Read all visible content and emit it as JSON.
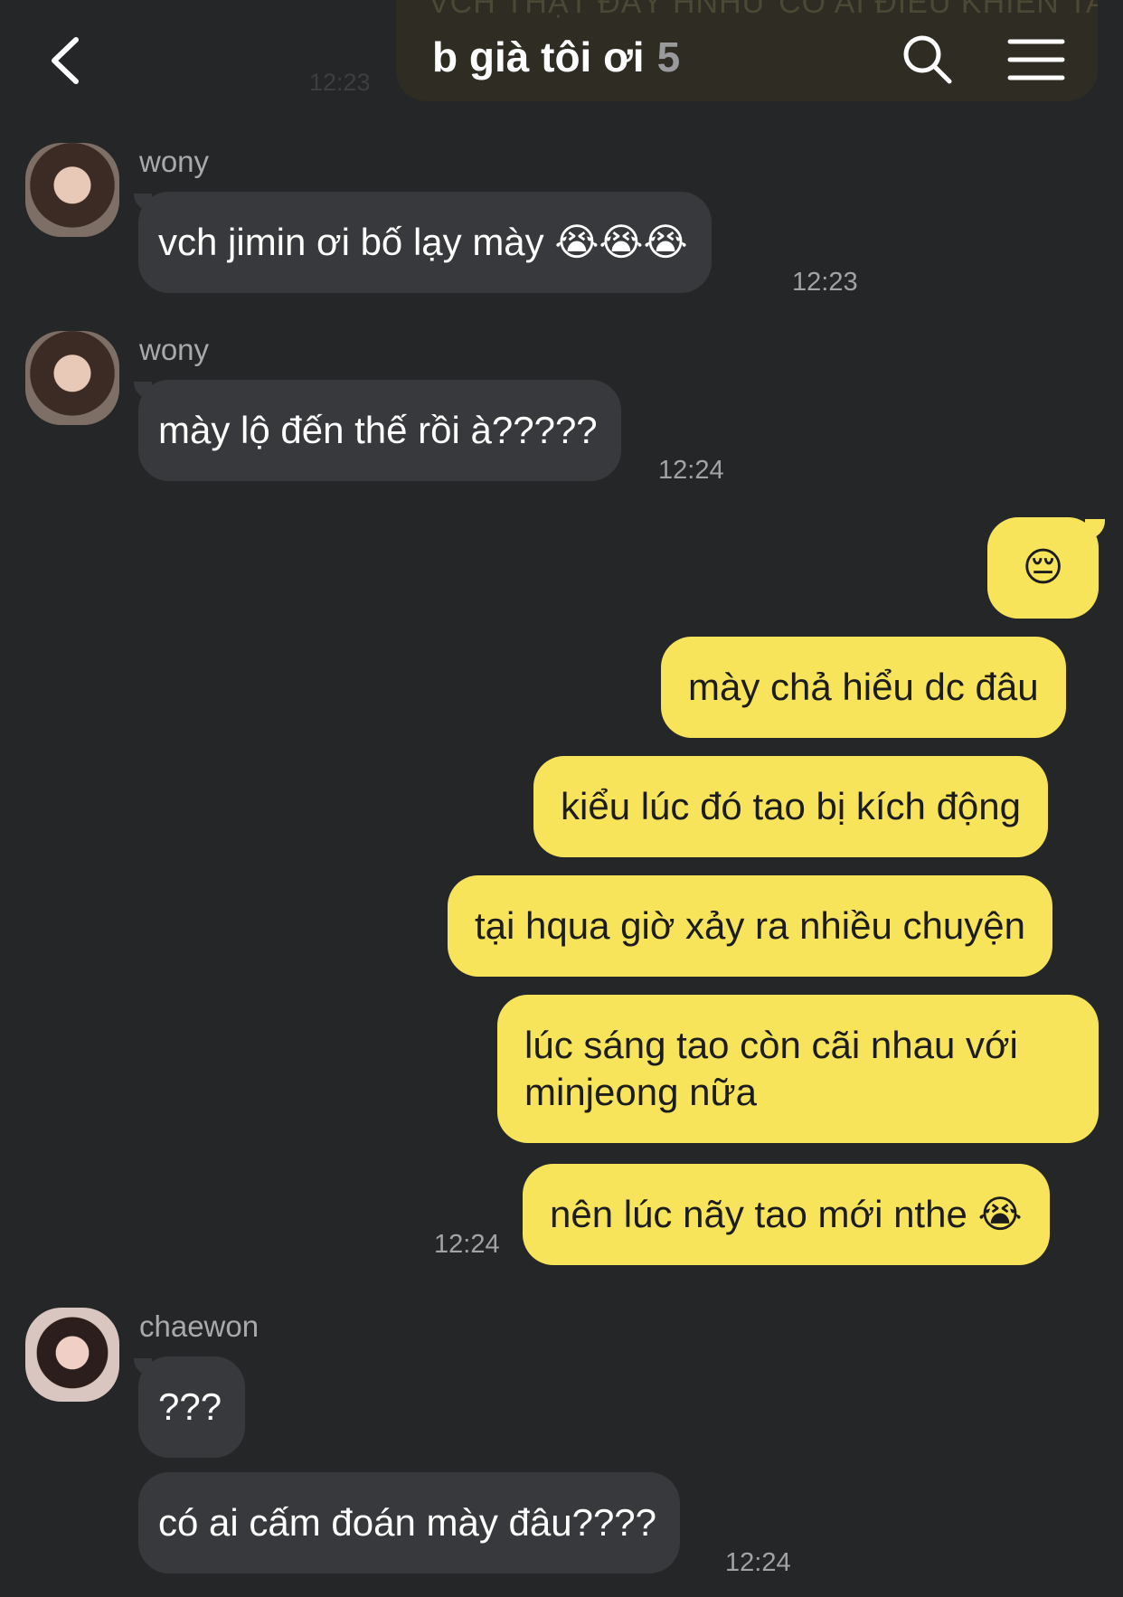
{
  "header": {
    "ghost_message": "VCH THẬT ĐẤY HNHƯ CÓ AI ĐIỀU KHIỂN TAO",
    "ghost_time": "12:23",
    "title": "b già tôi ơi",
    "member_count": "5",
    "back_icon": "chevron-left-icon",
    "search_icon": "search-icon",
    "menu_icon": "hamburger-menu-icon"
  },
  "messages": [
    {
      "sender": "wony",
      "text": "vch jimin ơi bố lạy mày 😭😭😭",
      "time": "12:23"
    },
    {
      "sender": "wony",
      "text": "mày lộ đến thế rồi à?????",
      "time": "12:24"
    },
    {
      "text": "😔"
    },
    {
      "text": "mày chả hiểu dc đâu"
    },
    {
      "text": "kiểu lúc đó tao bị kích động"
    },
    {
      "text": "tại hqua giờ xảy ra nhiều chuyện"
    },
    {
      "line1": "lúc sáng tao còn cãi nhau với",
      "line2": "minjeong nữa"
    },
    {
      "text": "nên lúc nãy tao mới nthe 😭",
      "time": "12:24"
    },
    {
      "sender": "chaewon",
      "text": "???"
    },
    {
      "text": "có ai cấm đoán mày đâu????",
      "time": "12:24"
    }
  ],
  "colors": {
    "background": "#252628",
    "incoming_bubble": "#38393c",
    "outgoing_bubble": "#f7e45a"
  }
}
